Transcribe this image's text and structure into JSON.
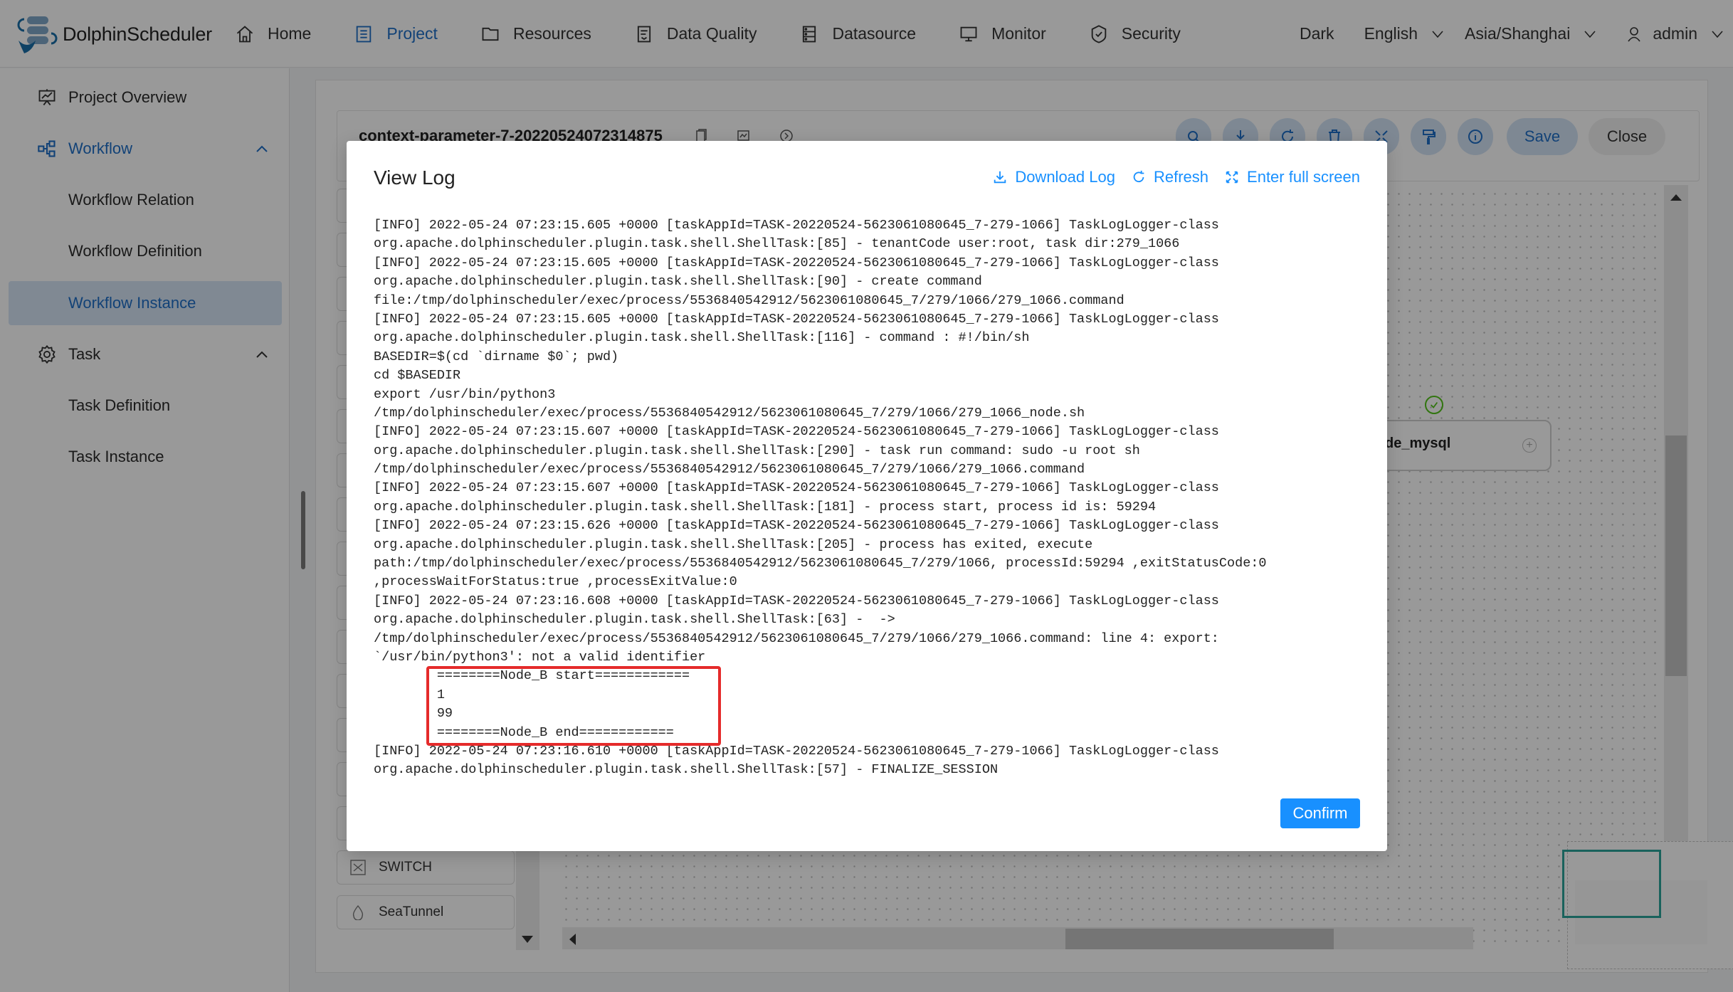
{
  "app": {
    "name": "DolphinScheduler"
  },
  "nav": {
    "items": [
      {
        "label": "Home",
        "icon": "home-icon"
      },
      {
        "label": "Project",
        "icon": "project-icon",
        "active": true
      },
      {
        "label": "Resources",
        "icon": "folder-icon"
      },
      {
        "label": "Data Quality",
        "icon": "data-quality-icon"
      },
      {
        "label": "Datasource",
        "icon": "datasource-icon"
      },
      {
        "label": "Monitor",
        "icon": "monitor-icon"
      },
      {
        "label": "Security",
        "icon": "shield-icon"
      }
    ],
    "theme": "Dark",
    "language": "English",
    "timezone": "Asia/Shanghai",
    "user": "admin"
  },
  "sidebar": {
    "items": [
      {
        "label": "Project Overview",
        "icon": "presentation-chart-icon",
        "type": "item"
      },
      {
        "label": "Workflow",
        "icon": "workflow-icon",
        "type": "group",
        "expanded": true
      },
      {
        "label": "Workflow Relation",
        "type": "subitem"
      },
      {
        "label": "Workflow Definition",
        "type": "subitem"
      },
      {
        "label": "Workflow Instance",
        "type": "subitem",
        "selected": true
      },
      {
        "label": "Task",
        "icon": "gear-icon",
        "type": "group",
        "expanded": true
      },
      {
        "label": "Task Definition",
        "type": "subitem"
      },
      {
        "label": "Task Instance",
        "type": "subitem"
      }
    ]
  },
  "workspace": {
    "title": "context-parameter-7-20220524072314875",
    "toolbar": {
      "icons": [
        "search-icon",
        "download-icon",
        "refresh-icon",
        "delete-icon",
        "fullscreen-icon",
        "format-brush-icon",
        "info-icon"
      ],
      "save_label": "Save",
      "close_label": "Close"
    },
    "task_types_visible": [
      "SWITCH",
      "SeaTunnel"
    ],
    "node": {
      "label_visible": "de_mysql",
      "status": "success"
    }
  },
  "modal": {
    "title": "View Log",
    "actions": {
      "download": "Download Log",
      "refresh": "Refresh",
      "fullscreen": "Enter full screen"
    },
    "confirm_label": "Confirm",
    "log_lines": [
      "[INFO] 2022-05-24 07:23:15.605 +0000 [taskAppId=TASK-20220524-5623061080645_7-279-1066] TaskLogLogger-class",
      "org.apache.dolphinscheduler.plugin.task.shell.ShellTask:[85] - tenantCode user:root, task dir:279_1066",
      "[INFO] 2022-05-24 07:23:15.605 +0000 [taskAppId=TASK-20220524-5623061080645_7-279-1066] TaskLogLogger-class",
      "org.apache.dolphinscheduler.plugin.task.shell.ShellTask:[90] - create command",
      "file:/tmp/dolphinscheduler/exec/process/5536840542912/5623061080645_7/279/1066/279_1066.command",
      "[INFO] 2022-05-24 07:23:15.605 +0000 [taskAppId=TASK-20220524-5623061080645_7-279-1066] TaskLogLogger-class",
      "org.apache.dolphinscheduler.plugin.task.shell.ShellTask:[116] - command : #!/bin/sh",
      "BASEDIR=$(cd `dirname $0`; pwd)",
      "cd $BASEDIR",
      "export /usr/bin/python3",
      "/tmp/dolphinscheduler/exec/process/5536840542912/5623061080645_7/279/1066/279_1066_node.sh",
      "[INFO] 2022-05-24 07:23:15.607 +0000 [taskAppId=TASK-20220524-5623061080645_7-279-1066] TaskLogLogger-class",
      "org.apache.dolphinscheduler.plugin.task.shell.ShellTask:[290] - task run command: sudo -u root sh",
      "/tmp/dolphinscheduler/exec/process/5536840542912/5623061080645_7/279/1066/279_1066.command",
      "[INFO] 2022-05-24 07:23:15.607 +0000 [taskAppId=TASK-20220524-5623061080645_7-279-1066] TaskLogLogger-class",
      "org.apache.dolphinscheduler.plugin.task.shell.ShellTask:[181] - process start, process id is: 59294",
      "[INFO] 2022-05-24 07:23:15.626 +0000 [taskAppId=TASK-20220524-5623061080645_7-279-1066] TaskLogLogger-class",
      "org.apache.dolphinscheduler.plugin.task.shell.ShellTask:[205] - process has exited, execute",
      "path:/tmp/dolphinscheduler/exec/process/5536840542912/5623061080645_7/279/1066, processId:59294 ,exitStatusCode:0",
      ",processWaitForStatus:true ,processExitValue:0",
      "[INFO] 2022-05-24 07:23:16.608 +0000 [taskAppId=TASK-20220524-5623061080645_7-279-1066] TaskLogLogger-class",
      "org.apache.dolphinscheduler.plugin.task.shell.ShellTask:[63] -  ->",
      "/tmp/dolphinscheduler/exec/process/5536840542912/5623061080645_7/279/1066/279_1066.command: line 4: export:",
      "`/usr/bin/python3': not a valid identifier",
      "        ========Node_B start============",
      "        1",
      "        99",
      "        ========Node_B end============",
      "[INFO] 2022-05-24 07:23:16.610 +0000 [taskAppId=TASK-20220524-5623061080645_7-279-1066] TaskLogLogger-class",
      "org.apache.dolphinscheduler.plugin.task.shell.ShellTask:[57] - FINALIZE_SESSION"
    ]
  },
  "colors": {
    "accent": "#1890ff",
    "nav_active": "#1f6fc6",
    "highlight_border": "#e52b2b",
    "success": "#52c41a",
    "minimap_view": "#2aa39a"
  }
}
